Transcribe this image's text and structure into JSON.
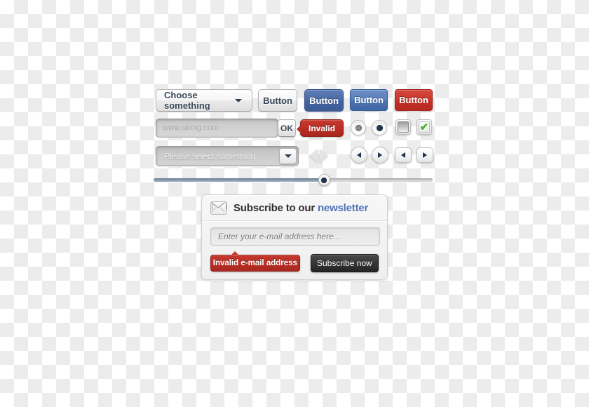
{
  "widgets": {
    "row1": {
      "select_label": "Choose something",
      "button_plain": "Button",
      "button_blue_dark": "Button",
      "button_blue": "Button",
      "button_red": "Button"
    },
    "row2": {
      "url_placeholder": "www.uiimg.com",
      "ok_label": "OK",
      "invalid_tooltip": "Invalid",
      "radio_one_state": "selected-gray",
      "radio_two_state": "selected-navy",
      "checkbox_one_state": "unchecked",
      "checkbox_two_state": "checked",
      "check_glyph": "✔"
    },
    "row3": {
      "select_placeholder": "Please select something",
      "prev_glyph": "◀",
      "next_glyph": "▶"
    },
    "slider": {
      "value_percent": 61
    }
  },
  "newsletter": {
    "title_prefix": "Subscribe to our ",
    "title_accent": "newsletter",
    "email_placeholder": "Enter your e-mail address here...",
    "invalid_label": "Invalid e-mail address",
    "subscribe_label": "Subscribe now"
  },
  "colors": {
    "accent_blue": "#4f73b8",
    "button_blue_dark": "#44649f",
    "button_blue": "#4e74b1",
    "button_red": "#c33127",
    "error_red": "#bb2e25",
    "dark_button": "#363636",
    "check_green": "#49b02a"
  }
}
